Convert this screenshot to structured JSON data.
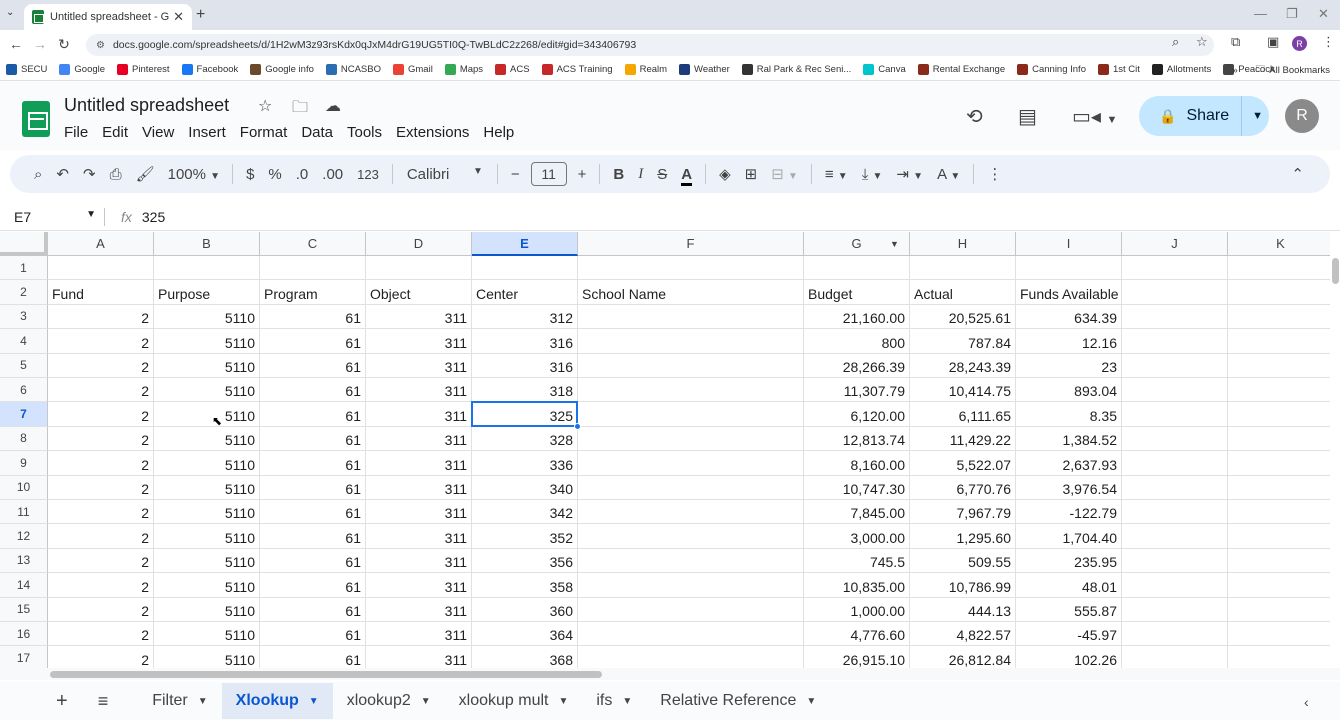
{
  "browser": {
    "tab_title": "Untitled spreadsheet - Google",
    "url": "docs.google.com/spreadsheets/d/1H2wM3z93rsKdx0qJxM4drG19UG5TI0Q-TwBLdC2z268/edit#gid=343406793",
    "profile_initial": "R",
    "bookmarks": [
      "SECU",
      "Google",
      "Pinterest",
      "Facebook",
      "Google info",
      "NCASBO",
      "Gmail",
      "Maps",
      "ACS",
      "ACS Training",
      "Realm",
      "Weather",
      "Ral Park & Rec Seni...",
      "Canva",
      "Rental Exchange",
      "Canning Info",
      "1st Cit",
      "Allotments",
      "Peacock"
    ],
    "all_bookmarks": "All Bookmarks"
  },
  "doc": {
    "title": "Untitled spreadsheet",
    "menus": [
      "File",
      "Edit",
      "View",
      "Insert",
      "Format",
      "Data",
      "Tools",
      "Extensions",
      "Help"
    ],
    "share_label": "Share",
    "avatar_initial": "R"
  },
  "toolbar": {
    "zoom": "100%",
    "currency": "$",
    "percent": "%",
    "dec_decrease": ".0",
    "dec_increase": ".00",
    "number_format": "123",
    "font": "Calibri",
    "font_size": "11"
  },
  "formula_bar": {
    "cell_ref": "E7",
    "fx": "fx",
    "value": "325"
  },
  "grid": {
    "columns": [
      "A",
      "B",
      "C",
      "D",
      "E",
      "F",
      "G",
      "H",
      "I",
      "J",
      "K"
    ],
    "selected_column": "E",
    "selected_row": "7",
    "rows": [
      {
        "n": "1",
        "cells": [
          "",
          "",
          "",
          "",
          "",
          "",
          "",
          "",
          "",
          "",
          ""
        ]
      },
      {
        "n": "2",
        "cells": [
          "Fund",
          "Purpose",
          "Program",
          "Object",
          "Center",
          "School Name",
          "Budget",
          "Actual",
          "Funds Available",
          "",
          ""
        ]
      },
      {
        "n": "3",
        "cells": [
          "2",
          "5110",
          "61",
          "311",
          "312",
          "",
          "21,160.00",
          "20,525.61",
          "634.39",
          "",
          ""
        ]
      },
      {
        "n": "4",
        "cells": [
          "2",
          "5110",
          "61",
          "311",
          "316",
          "",
          "800",
          "787.84",
          "12.16",
          "",
          ""
        ]
      },
      {
        "n": "5",
        "cells": [
          "2",
          "5110",
          "61",
          "311",
          "316",
          "",
          "28,266.39",
          "28,243.39",
          "23",
          "",
          ""
        ]
      },
      {
        "n": "6",
        "cells": [
          "2",
          "5110",
          "61",
          "311",
          "318",
          "",
          "11,307.79",
          "10,414.75",
          "893.04",
          "",
          ""
        ]
      },
      {
        "n": "7",
        "cells": [
          "2",
          "5110",
          "61",
          "311",
          "325",
          "",
          "6,120.00",
          "6,111.65",
          "8.35",
          "",
          ""
        ]
      },
      {
        "n": "8",
        "cells": [
          "2",
          "5110",
          "61",
          "311",
          "328",
          "",
          "12,813.74",
          "11,429.22",
          "1,384.52",
          "",
          ""
        ]
      },
      {
        "n": "9",
        "cells": [
          "2",
          "5110",
          "61",
          "311",
          "336",
          "",
          "8,160.00",
          "5,522.07",
          "2,637.93",
          "",
          ""
        ]
      },
      {
        "n": "10",
        "cells": [
          "2",
          "5110",
          "61",
          "311",
          "340",
          "",
          "10,747.30",
          "6,770.76",
          "3,976.54",
          "",
          ""
        ]
      },
      {
        "n": "11",
        "cells": [
          "2",
          "5110",
          "61",
          "311",
          "342",
          "",
          "7,845.00",
          "7,967.79",
          "-122.79",
          "",
          ""
        ]
      },
      {
        "n": "12",
        "cells": [
          "2",
          "5110",
          "61",
          "311",
          "352",
          "",
          "3,000.00",
          "1,295.60",
          "1,704.40",
          "",
          ""
        ]
      },
      {
        "n": "13",
        "cells": [
          "2",
          "5110",
          "61",
          "311",
          "356",
          "",
          "745.5",
          "509.55",
          "235.95",
          "",
          ""
        ]
      },
      {
        "n": "14",
        "cells": [
          "2",
          "5110",
          "61",
          "311",
          "358",
          "",
          "10,835.00",
          "10,786.99",
          "48.01",
          "",
          ""
        ]
      },
      {
        "n": "15",
        "cells": [
          "2",
          "5110",
          "61",
          "311",
          "360",
          "",
          "1,000.00",
          "444.13",
          "555.87",
          "",
          ""
        ]
      },
      {
        "n": "16",
        "cells": [
          "2",
          "5110",
          "61",
          "311",
          "364",
          "",
          "4,776.60",
          "4,822.57",
          "-45.97",
          "",
          ""
        ]
      },
      {
        "n": "17",
        "cells": [
          "2",
          "5110",
          "61",
          "311",
          "368",
          "",
          "26,915.10",
          "26,812.84",
          "102.26",
          "",
          ""
        ]
      }
    ]
  },
  "sheet_tabs": [
    {
      "label": "Filter",
      "active": false
    },
    {
      "label": "Xlookup",
      "active": true
    },
    {
      "label": "xlookup2",
      "active": false
    },
    {
      "label": "xlookup mult",
      "active": false
    },
    {
      "label": "ifs",
      "active": false
    },
    {
      "label": "Relative Reference",
      "active": false
    }
  ],
  "colors": {
    "accent": "#1a73e8",
    "selected_header_bg": "#d3e3fd",
    "share_bg": "#c2e7ff",
    "sheets_green": "#0f9d58"
  }
}
